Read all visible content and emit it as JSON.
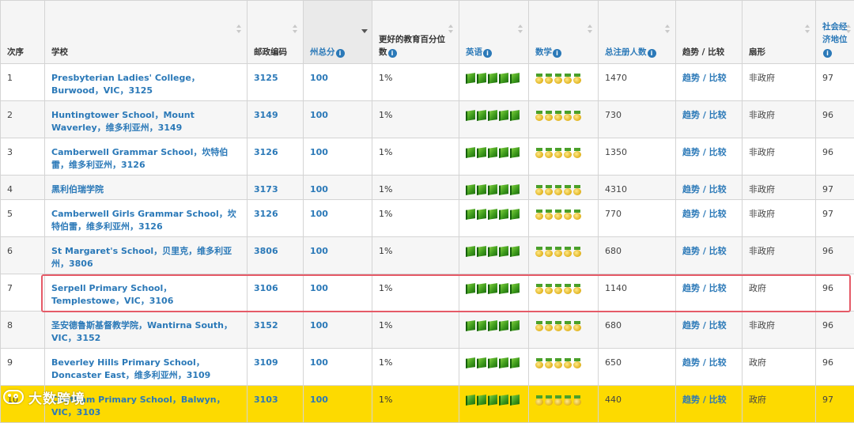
{
  "headers": {
    "rank": "次序",
    "school": "学校",
    "postcode": "邮政编码",
    "state_score": "州总分",
    "percentile": "更好的教育百分位数",
    "english": "英语",
    "maths": "数学",
    "enrolments": "总注册人数",
    "trends": "趋势 / 比较",
    "sector": "扇形",
    "icsea": "社会经济地位"
  },
  "icons": {
    "english_rating": "green-book-icon",
    "maths_rating": "gold-medal-icon",
    "info": "info-icon"
  },
  "colors": {
    "link": "#2b79b8",
    "highlight_row": "#fdda00",
    "outline": "#e55a67"
  },
  "rows": [
    {
      "rank": "1",
      "school": "Presbyterian Ladies' College，Burwood，VIC，3125",
      "postcode": "3125",
      "state_score": "100",
      "percentile": "1%",
      "english_rating": 5,
      "maths_rating": 5,
      "enrolments": "1470",
      "trends": "趋势 / 比较",
      "sector": "非政府",
      "icsea": "97"
    },
    {
      "rank": "2",
      "school": "Huntingtower School，Mount Waverley，维多利亚州，3149",
      "postcode": "3149",
      "state_score": "100",
      "percentile": "1%",
      "english_rating": 5,
      "maths_rating": 5,
      "enrolments": "730",
      "trends": "趋势 / 比较",
      "sector": "非政府",
      "icsea": "96"
    },
    {
      "rank": "3",
      "school": "Camberwell Grammar School，坎特伯雷，维多利亚州，3126",
      "postcode": "3126",
      "state_score": "100",
      "percentile": "1%",
      "english_rating": 5,
      "maths_rating": 5,
      "enrolments": "1350",
      "trends": "趋势 / 比较",
      "sector": "非政府",
      "icsea": "96"
    },
    {
      "rank": "4",
      "school": "黑利伯瑞学院",
      "postcode": "3173",
      "state_score": "100",
      "percentile": "1%",
      "english_rating": 5,
      "maths_rating": 5,
      "enrolments": "4310",
      "trends": "趋势 / 比较",
      "sector": "非政府",
      "icsea": "97"
    },
    {
      "rank": "5",
      "school": "Camberwell Girls Grammar School，坎特伯雷，维多利亚州，3126",
      "postcode": "3126",
      "state_score": "100",
      "percentile": "1%",
      "english_rating": 5,
      "maths_rating": 5,
      "enrolments": "770",
      "trends": "趋势 / 比较",
      "sector": "非政府",
      "icsea": "97"
    },
    {
      "rank": "6",
      "school": "St Margaret's School，贝里克，维多利亚州，3806",
      "postcode": "3806",
      "state_score": "100",
      "percentile": "1%",
      "english_rating": 5,
      "maths_rating": 5,
      "enrolments": "680",
      "trends": "趋势 / 比较",
      "sector": "非政府",
      "icsea": "96"
    },
    {
      "rank": "7",
      "school": "Serpell Primary School，Templestowe，VIC，3106",
      "postcode": "3106",
      "state_score": "100",
      "percentile": "1%",
      "english_rating": 5,
      "maths_rating": 5,
      "enrolments": "1140",
      "trends": "趋势 / 比较",
      "sector": "政府",
      "icsea": "96"
    },
    {
      "rank": "8",
      "school": "圣安德鲁斯基督教学院，Wantirna South，VIC，3152",
      "postcode": "3152",
      "state_score": "100",
      "percentile": "1%",
      "english_rating": 5,
      "maths_rating": 5,
      "enrolments": "680",
      "trends": "趋势 / 比较",
      "sector": "非政府",
      "icsea": "96"
    },
    {
      "rank": "9",
      "school": "Beverley Hills Primary School，Doncaster East，维多利亚州，3109",
      "postcode": "3109",
      "state_score": "100",
      "percentile": "1%",
      "english_rating": 5,
      "maths_rating": 5,
      "enrolments": "650",
      "trends": "趋势 / 比较",
      "sector": "政府",
      "icsea": "96"
    },
    {
      "rank": "10",
      "school": "Chatham Primary School，Balwyn，VIC，3103",
      "postcode": "3103",
      "state_score": "100",
      "percentile": "1%",
      "english_rating": 5,
      "maths_rating": 5,
      "enrolments": "440",
      "trends": "趋势 / 比较",
      "sector": "政府",
      "icsea": "97"
    }
  ],
  "watermark": "大数跨境"
}
